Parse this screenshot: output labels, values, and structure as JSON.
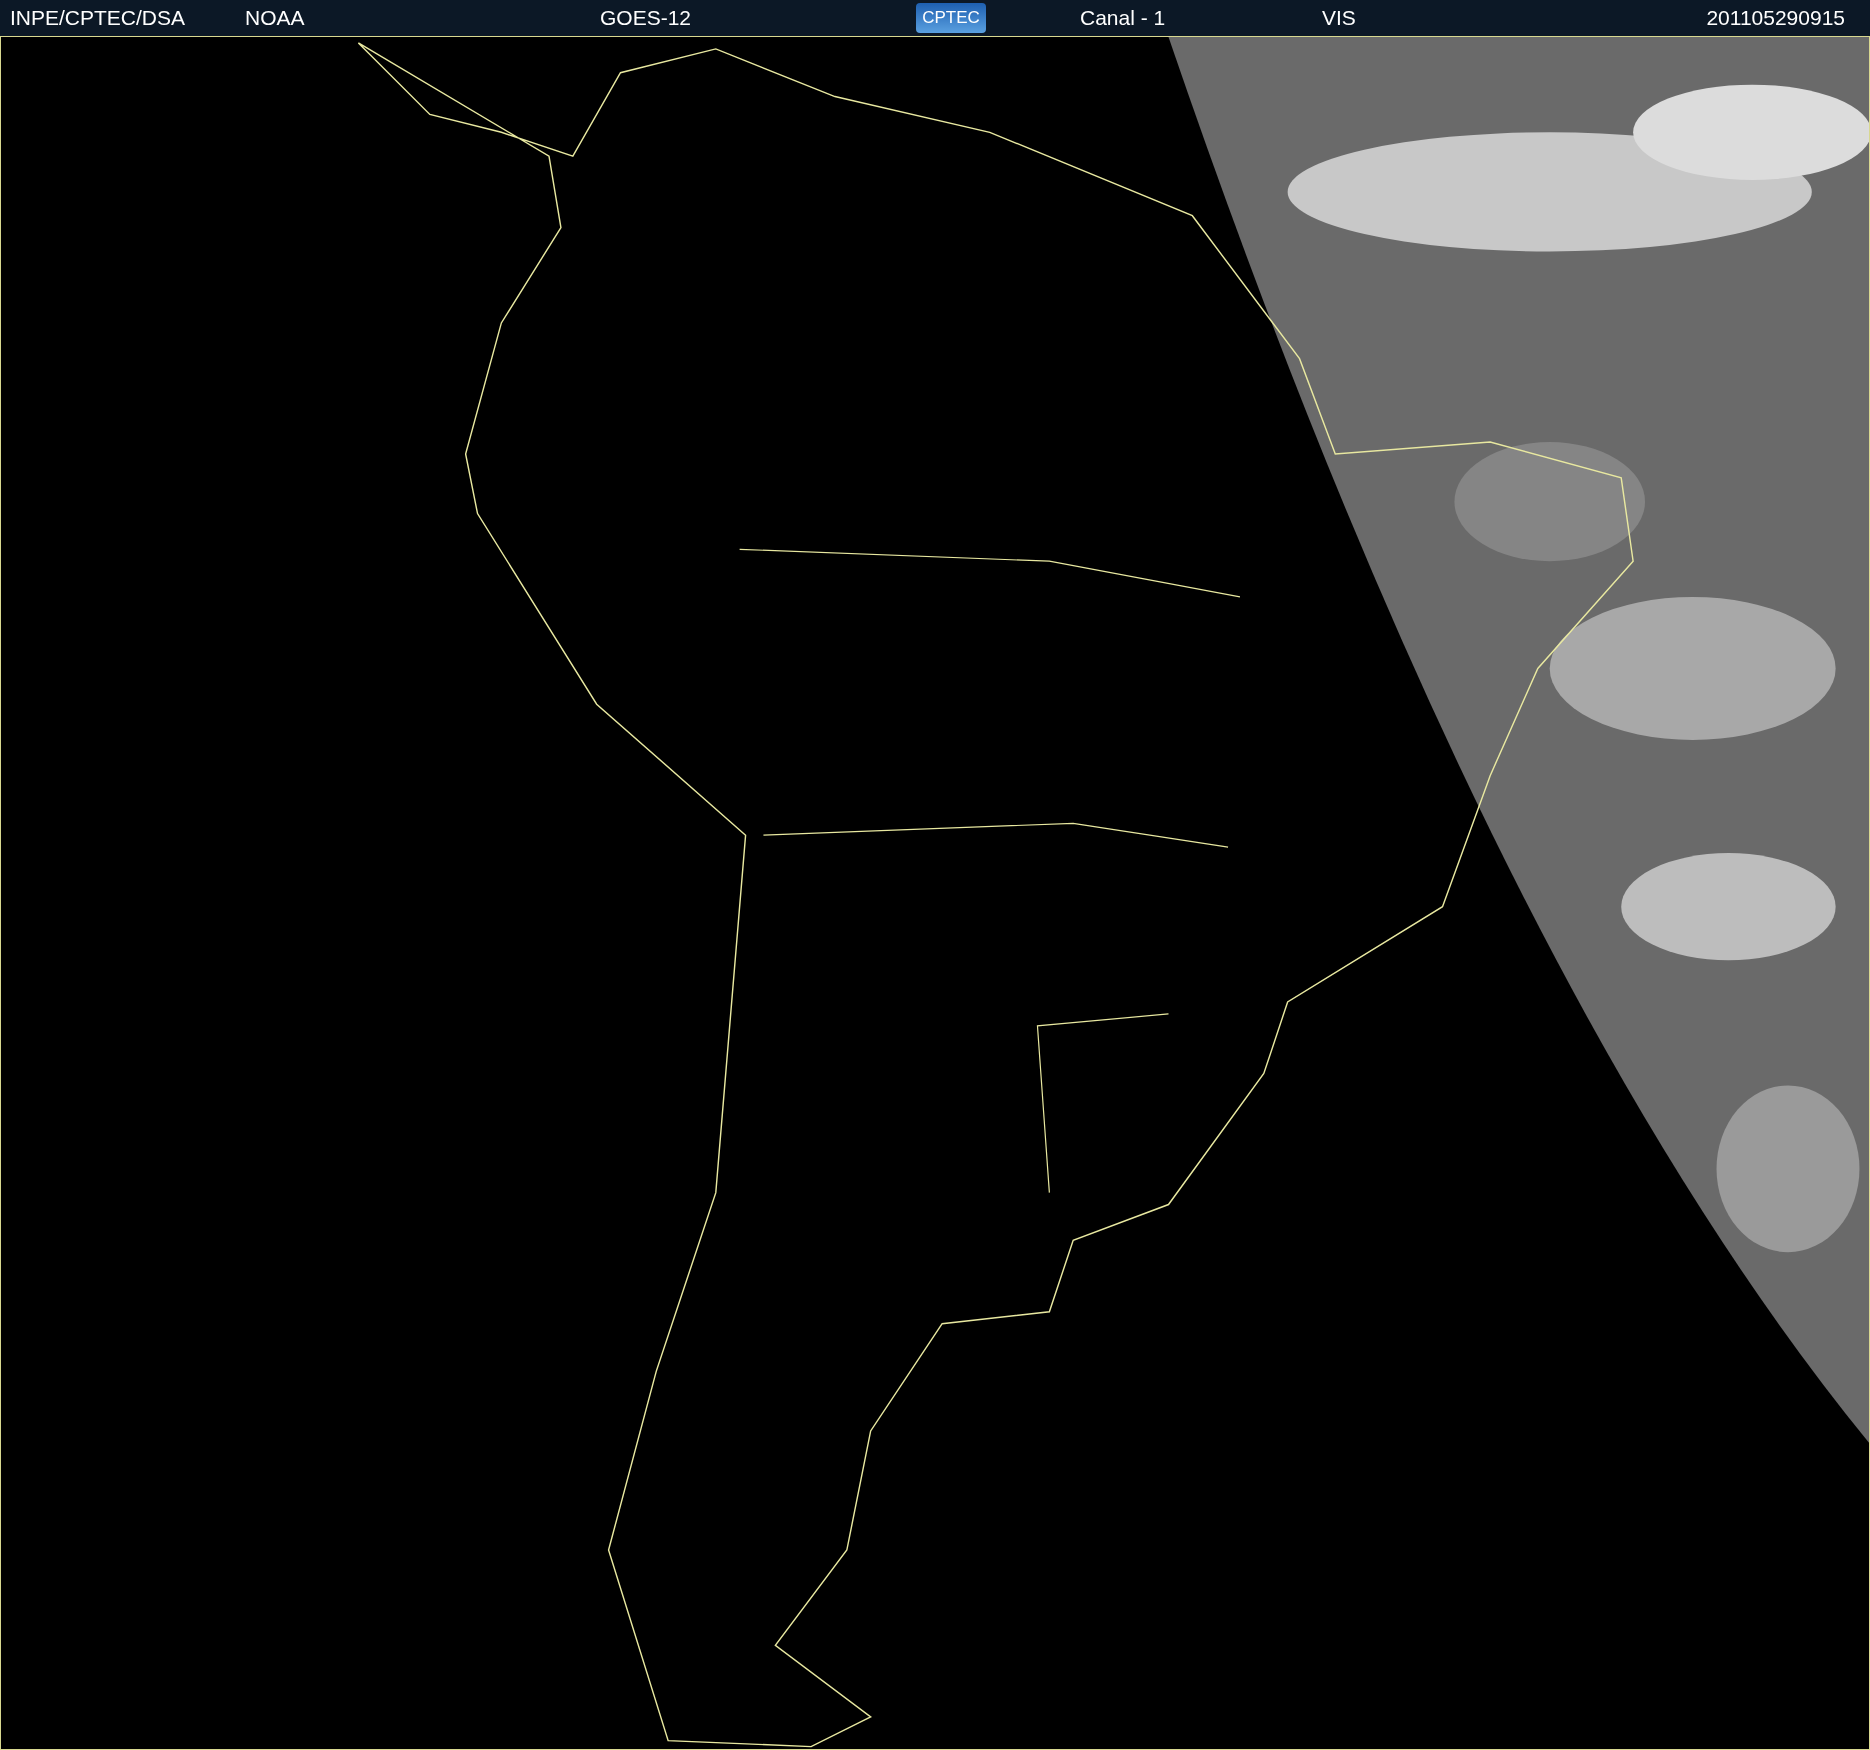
{
  "header": {
    "items": [
      {
        "kind": "text",
        "text": "INPE/CPTEC/DSA"
      },
      {
        "kind": "text",
        "text": "NOAA"
      },
      {
        "kind": "text",
        "text": "GOES-12"
      },
      {
        "kind": "logo",
        "text": "CPTEC"
      },
      {
        "kind": "text",
        "text": "Canal - 1"
      },
      {
        "kind": "text",
        "text": "VIS"
      },
      {
        "kind": "text",
        "text": "201105290915"
      }
    ]
  }
}
